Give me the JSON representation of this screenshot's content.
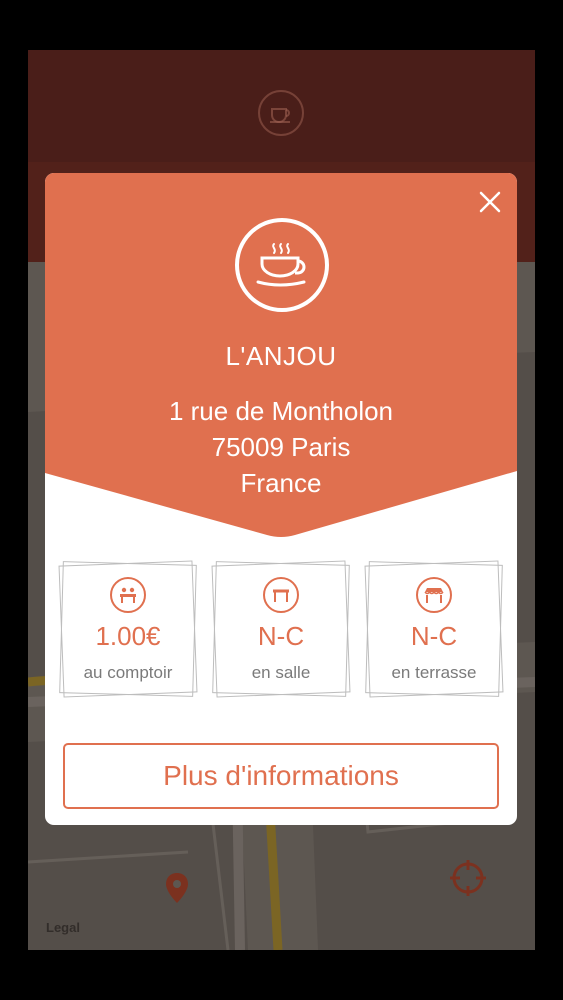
{
  "header": {
    "icon": "coffee-cup-icon"
  },
  "map": {
    "legal_label": "Legal",
    "pin_icon": "map-pin-icon",
    "locate_icon": "crosshair-icon"
  },
  "modal": {
    "close_icon": "close-icon",
    "venue_icon": "coffee-cup-icon",
    "name": "L'ANJOU",
    "address_line1": "1 rue de Montholon",
    "address_line2": "75009 Paris",
    "address_line3": "France",
    "prices": [
      {
        "icon": "bar-counter-icon",
        "value": "1.00€",
        "label": "au comptoir"
      },
      {
        "icon": "table-icon",
        "value": "N-C",
        "label": "en salle"
      },
      {
        "icon": "terrace-awning-icon",
        "value": "N-C",
        "label": "en terrasse"
      }
    ],
    "more_button": "Plus d'informations"
  },
  "colors": {
    "accent": "#e0704f",
    "header_dark": "#6e2d25",
    "text_muted": "#7a7a7a"
  }
}
